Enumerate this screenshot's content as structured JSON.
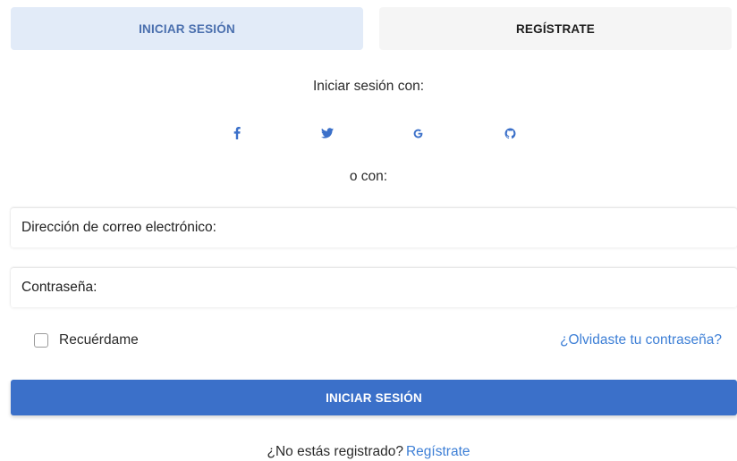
{
  "tabs": {
    "login": "INICIAR SESIÓN",
    "register": "REGÍSTRATE"
  },
  "social": {
    "heading": "Iniciar sesión con:",
    "icons": [
      "facebook-icon",
      "twitter-icon",
      "google-icon",
      "github-icon"
    ],
    "icon_color": "#3b70c9"
  },
  "or_with": "o con:",
  "form": {
    "email_placeholder": "Dirección de correo electrónico:",
    "password_placeholder": "Contraseña:",
    "remember_label": "Recuérdame",
    "remember_checked": false,
    "forgot_link": "¿Olvidaste tu contraseña?",
    "submit_label": "INICIAR SESIÓN"
  },
  "footer": {
    "question": "¿No estás registrado?",
    "link": "Regístrate"
  },
  "colors": {
    "primary": "#3b70c9",
    "link": "#3d7fd6",
    "active_tab_bg": "#e2ebf8",
    "active_tab_text": "#4a6fae"
  }
}
